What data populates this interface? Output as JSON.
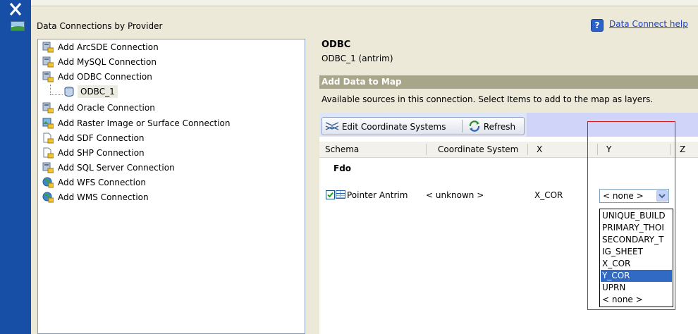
{
  "strip": {
    "close_icon": "close-x-icon",
    "map_icon": "map-image-icon"
  },
  "panel": {
    "section_title": "Data Connections by Provider",
    "help_icon_text": "?",
    "help_link": "Data Connect help"
  },
  "tree": {
    "items": [
      {
        "label": "Add ArcSDE Connection",
        "icon": "database-connection-icon"
      },
      {
        "label": "Add MySQL Connection",
        "icon": "database-connection-icon"
      },
      {
        "label": "Add ODBC Connection",
        "icon": "database-connection-icon"
      },
      {
        "label": "ODBC_1",
        "icon": "database-cylinder-icon"
      },
      {
        "label": "Add Oracle Connection",
        "icon": "database-connection-icon"
      },
      {
        "label": "Add Raster Image or Surface Connection",
        "icon": "raster-connection-icon"
      },
      {
        "label": "Add SDF Connection",
        "icon": "file-connection-icon"
      },
      {
        "label": "Add SHP Connection",
        "icon": "file-connection-icon"
      },
      {
        "label": "Add SQL Server Connection",
        "icon": "database-connection-icon"
      },
      {
        "label": "Add WFS Connection",
        "icon": "globe-connection-icon"
      },
      {
        "label": "Add WMS Connection",
        "icon": "globe-connection-icon"
      }
    ]
  },
  "detail": {
    "title": "ODBC",
    "subtitle": "ODBC_1 (antrim)",
    "add_bar": "Add Data to Map",
    "available_text": "Available sources in this connection.  Select Items to add to the map as layers.",
    "toolbar": {
      "edit_label": "Edit Coordinate Systems",
      "refresh_label": "Refresh"
    },
    "headers": {
      "schema": "Schema",
      "coord": "Coordinate System",
      "x": "X",
      "y": "Y",
      "z": "Z"
    },
    "group": "Fdo",
    "row": {
      "name": "Pointer Antrim",
      "coord": "< unknown >",
      "x": "X_COR",
      "checked": true
    },
    "dropdown": {
      "value": "< none >",
      "options": [
        "UNIQUE_BUILD",
        "PRIMARY_THOI",
        "SECONDARY_T",
        "IG_SHEET",
        "X_COR",
        "Y_COR",
        "UPRN",
        "< none >"
      ],
      "highlighted": "Y_COR"
    }
  },
  "colors": {
    "strip": "#174fa6",
    "highlight": "#316ac5",
    "annotation": "#e01818",
    "link": "#1c3fcf"
  }
}
